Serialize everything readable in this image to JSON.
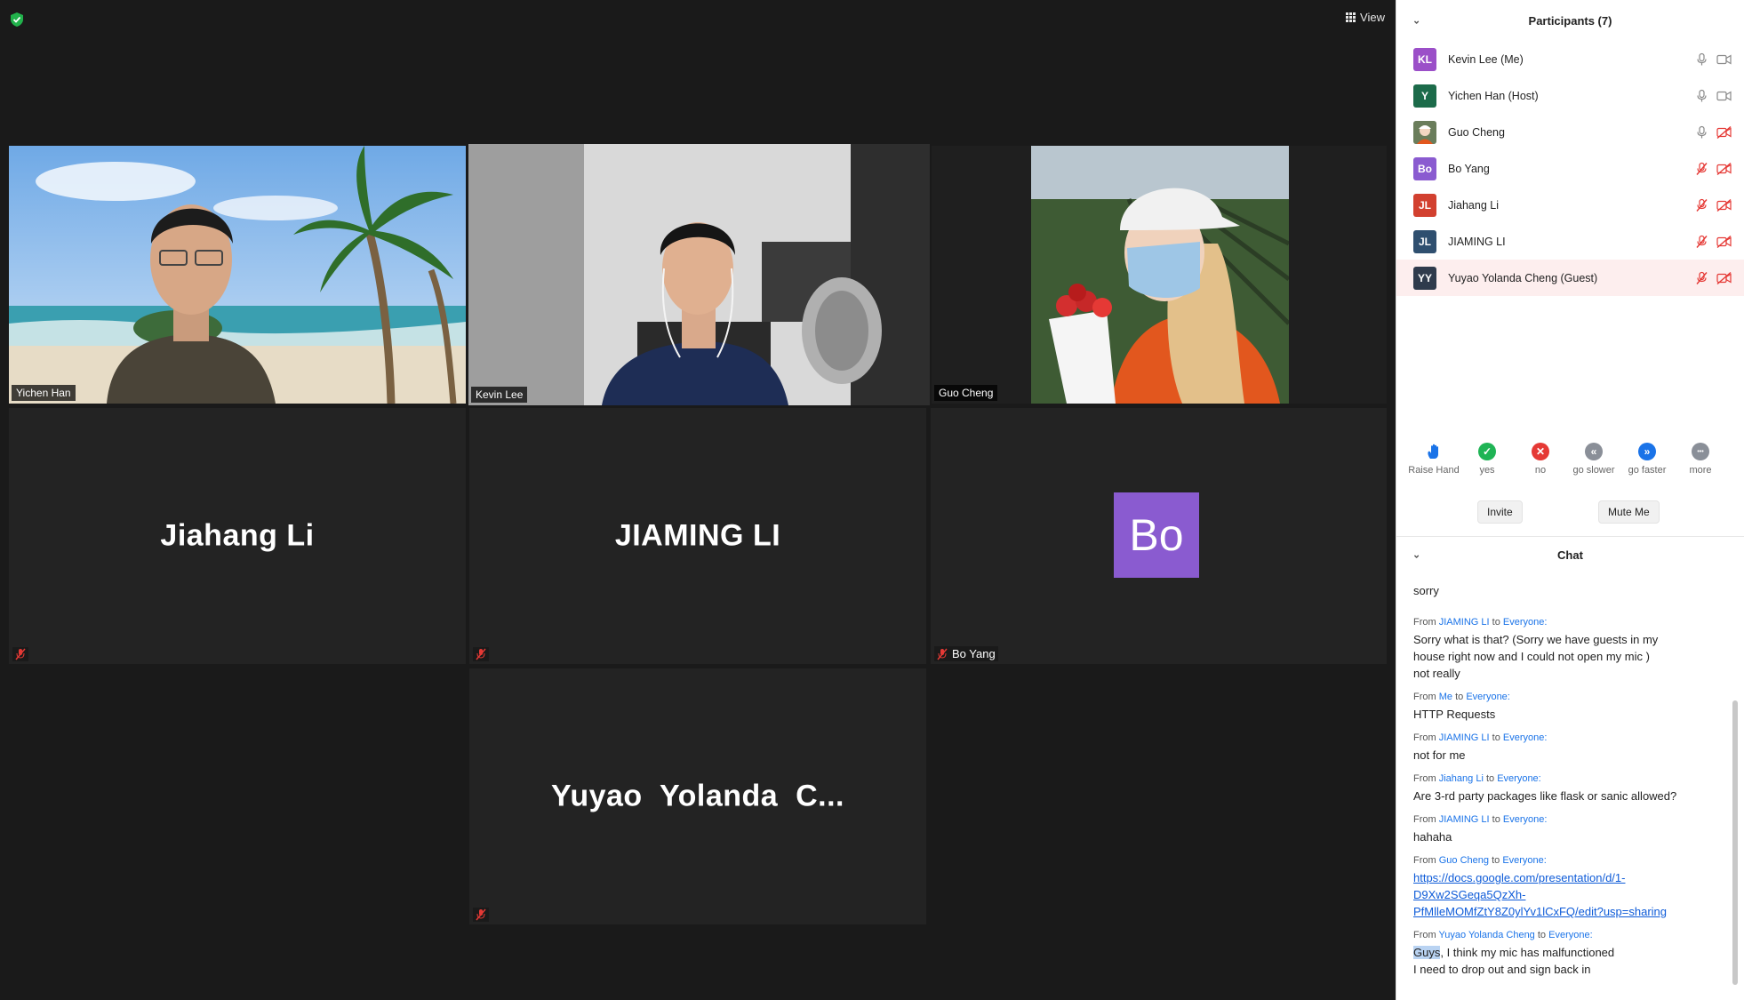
{
  "toolbar": {
    "view_label": "View"
  },
  "gallery": {
    "yichen": {
      "name": "Yichen Han"
    },
    "kevin": {
      "name": "Kevin Lee"
    },
    "guo": {
      "name": "Guo Cheng"
    },
    "jiahang": {
      "display": "Jiahang Li"
    },
    "jiaming": {
      "display": "JIAMING LI"
    },
    "bo": {
      "initials": "Bo",
      "name": "Bo Yang"
    },
    "yuyao": {
      "display": "Yuyao  Yolanda  C..."
    }
  },
  "participants": {
    "title": "Participants (7)",
    "list": [
      {
        "initials": "KL",
        "name": "Kevin Lee (Me)",
        "color": "#9b4fc8"
      },
      {
        "initials": "Y",
        "name": "Yichen Han (Host)",
        "color": "#1c6b4a"
      },
      {
        "initials": "",
        "name": "Guo Cheng",
        "color": "#c9c9c9"
      },
      {
        "initials": "Bo",
        "name": "Bo Yang",
        "color": "#8a5bd0"
      },
      {
        "initials": "JL",
        "name": "Jiahang Li",
        "color": "#d2402f"
      },
      {
        "initials": "JL",
        "name": "JIAMING LI",
        "color": "#2f4f6f"
      },
      {
        "initials": "YY",
        "name": "Yuyao Yolanda Cheng (Guest)",
        "color": "#2f3b4c"
      }
    ]
  },
  "reactions": [
    {
      "label": "Raise Hand",
      "icon": "raise-hand-icon",
      "color": "#1a73e8"
    },
    {
      "label": "yes",
      "icon": "check-icon",
      "color": "#1fb455"
    },
    {
      "label": "no",
      "icon": "x-icon",
      "color": "#e53935"
    },
    {
      "label": "go slower",
      "icon": "rewind-icon",
      "color": "#8a8f98"
    },
    {
      "label": "go faster",
      "icon": "fast-forward-icon",
      "color": "#1a73e8"
    },
    {
      "label": "more",
      "icon": "more-icon",
      "color": "#8a8f98"
    }
  ],
  "buttons": {
    "invite": "Invite",
    "mute_me": "Mute Me"
  },
  "chat": {
    "title": "Chat",
    "partial_top": "sorry",
    "messages": [
      {
        "from": "JIAMING LI",
        "to": "Everyone:",
        "lines": [
          "Sorry what is that? (Sorry we have guests in my",
          "house right now and I could not open my mic )",
          "not really"
        ]
      },
      {
        "from": "Me",
        "to": "Everyone:",
        "lines": [
          "HTTP Requests"
        ]
      },
      {
        "from": "JIAMING LI",
        "to": "Everyone:",
        "lines": [
          "not for me"
        ]
      },
      {
        "from": "Jiahang Li",
        "to": "Everyone:",
        "lines": [
          "Are 3-rd party packages like flask or sanic allowed?"
        ]
      },
      {
        "from": "JIAMING LI",
        "to": "Everyone:",
        "lines": [
          "hahaha"
        ]
      },
      {
        "from": "Guo Cheng",
        "to": "Everyone:",
        "link_lines": [
          "https://docs.google.com/presentation/d/1-",
          "D9Xw2SGeqa5QzXh-",
          "PfMlleMOMfZtY8Z0ylYv1lCxFQ/edit?usp=sharing"
        ]
      },
      {
        "from": "Yuyao Yolanda Cheng",
        "to": "Everyone:",
        "selected": "Guys",
        "first_rest": ", I think my mic has malfunctioned",
        "lines": [
          "I need to drop out and sign back in"
        ]
      }
    ],
    "from_word": "From",
    "to_word": "to"
  }
}
